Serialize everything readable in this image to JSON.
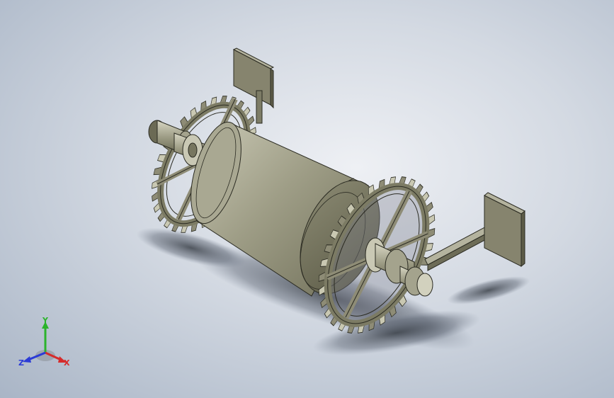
{
  "viewport": {
    "background_center": "#eef0f4",
    "background_edge": "#a9b5c6"
  },
  "model": {
    "part_color": "#8e8c76",
    "part_dark": "#55543f",
    "part_light": "#c9c8b2",
    "edge_color": "#2b2b22"
  },
  "triad": {
    "x_label": "X",
    "y_label": "Y",
    "z_label": "Z",
    "x_color": "#d62b2b",
    "y_color": "#2bb32b",
    "z_color": "#2b3bd6"
  }
}
